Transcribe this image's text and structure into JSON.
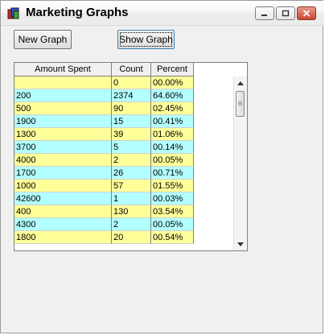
{
  "window": {
    "title": "Marketing Graphs"
  },
  "toolbar": {
    "new_graph_label": "New Graph",
    "show_graph_label": "Show Graph"
  },
  "table": {
    "columns": [
      "Amount Spent",
      "Count",
      "Percent"
    ],
    "rows": [
      {
        "amount": "",
        "count": "0",
        "percent": "00.00%",
        "color": "yellow"
      },
      {
        "amount": "200",
        "count": "2374",
        "percent": "64.60%",
        "color": "cyan"
      },
      {
        "amount": "500",
        "count": "90",
        "percent": "02.45%",
        "color": "yellow"
      },
      {
        "amount": "1900",
        "count": "15",
        "percent": "00.41%",
        "color": "cyan"
      },
      {
        "amount": "1300",
        "count": "39",
        "percent": "01.06%",
        "color": "yellow"
      },
      {
        "amount": "3700",
        "count": "5",
        "percent": "00.14%",
        "color": "cyan"
      },
      {
        "amount": "4000",
        "count": "2",
        "percent": "00.05%",
        "color": "yellow"
      },
      {
        "amount": "1700",
        "count": "26",
        "percent": "00.71%",
        "color": "cyan"
      },
      {
        "amount": "1000",
        "count": "57",
        "percent": "01.55%",
        "color": "yellow"
      },
      {
        "amount": "42600",
        "count": "1",
        "percent": "00.03%",
        "color": "cyan"
      },
      {
        "amount": "400",
        "count": "130",
        "percent": "03.54%",
        "color": "yellow"
      },
      {
        "amount": "4300",
        "count": "2",
        "percent": "00.05%",
        "color": "cyan"
      },
      {
        "amount": "1800",
        "count": "20",
        "percent": "00.54%",
        "color": "yellow"
      }
    ]
  },
  "colors": {
    "row_yellow": "#ffff99",
    "row_cyan": "#b3ffff"
  }
}
